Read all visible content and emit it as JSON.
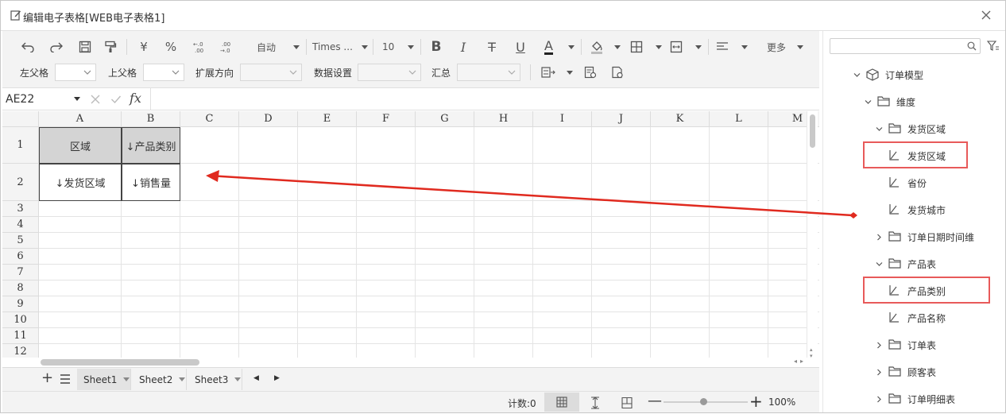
{
  "window": {
    "title": "编辑电子表格[WEB电子表格1]"
  },
  "toolbar": {
    "currency": "¥",
    "percent": "%",
    "auto_label": "自动",
    "font_name": "Times ...",
    "font_size": "10",
    "more_label": "更多",
    "row2": {
      "left_parent": "左父格",
      "top_parent": "上父格",
      "expand_direction": "扩展方向",
      "data_settings": "数据设置",
      "summary": "汇总"
    }
  },
  "formula_bar": {
    "name_box": "AE22",
    "fx": "fx"
  },
  "grid": {
    "columns": [
      "A",
      "B",
      "C",
      "D",
      "E",
      "F",
      "G",
      "H",
      "I",
      "J",
      "K",
      "L",
      "M"
    ],
    "rows": [
      "1",
      "2",
      "3",
      "4",
      "5",
      "6",
      "7",
      "8",
      "9",
      "10",
      "11",
      "12"
    ],
    "cells": {
      "A1": "区域",
      "B1": "↓产品类别",
      "A2": "↓发货区域",
      "B2": "↓销售量"
    }
  },
  "sheets": {
    "tabs": [
      "Sheet1",
      "Sheet2",
      "Sheet3"
    ],
    "active": "Sheet1"
  },
  "status": {
    "count": "计数:0",
    "zoom": "100%"
  },
  "panel": {
    "tree": [
      {
        "label": "订单模型",
        "type": "cube",
        "level": 0,
        "expanded": true
      },
      {
        "label": "维度",
        "type": "folder",
        "level": 1,
        "expanded": true
      },
      {
        "label": "发货区域",
        "type": "folder",
        "level": 2,
        "expanded": true
      },
      {
        "label": "发货区域",
        "type": "dimension",
        "level": 3,
        "highlighted": true
      },
      {
        "label": "省份",
        "type": "dimension",
        "level": 3
      },
      {
        "label": "发货城市",
        "type": "dimension",
        "level": 3
      },
      {
        "label": "订单日期时间维",
        "type": "folder",
        "level": 2,
        "expanded": false
      },
      {
        "label": "产品表",
        "type": "folder",
        "level": 2,
        "expanded": true
      },
      {
        "label": "产品类别",
        "type": "dimension",
        "level": 3,
        "highlighted": true
      },
      {
        "label": "产品名称",
        "type": "dimension",
        "level": 3
      },
      {
        "label": "订单表",
        "type": "folder",
        "level": 2,
        "expanded": false
      },
      {
        "label": "顾客表",
        "type": "folder",
        "level": 2,
        "expanded": false
      },
      {
        "label": "订单明细表",
        "type": "folder",
        "level": 2,
        "expanded": false
      }
    ]
  },
  "colors": {
    "highlight_box": "#e85a5a",
    "arrow": "#e02a1f",
    "header_fill": "#d4d4d4"
  }
}
